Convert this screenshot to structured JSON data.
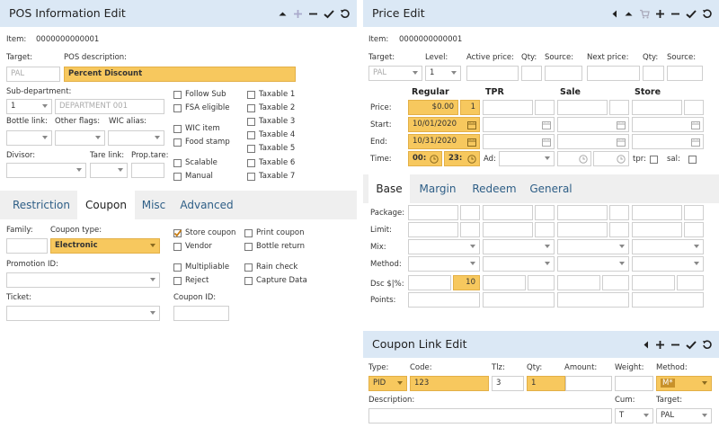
{
  "pos": {
    "title": "POS Information Edit",
    "item_label": "Item:",
    "item_value": "0000000000001",
    "target_label": "Target:",
    "target_value": "PAL",
    "posdesc_label": "POS description:",
    "posdesc_value": "Percent Discount",
    "subdept_label": "Sub-department:",
    "subdept_num": "1",
    "subdept_name": "DEPARTMENT 001",
    "bottle_label": "Bottle link:",
    "flags_label": "Other flags:",
    "wic_alias_label": "WIC alias:",
    "divisor_label": "Divisor:",
    "tare_label": "Tare link:",
    "prop_tare_label": "Prop.tare:",
    "checks_a": [
      "Follow Sub",
      "FSA eligible",
      "WIC item",
      "Food stamp",
      "Scalable",
      "Manual"
    ],
    "checks_b": [
      "Taxable 1",
      "Taxable 2",
      "Taxable 3",
      "Taxable 4",
      "Taxable 5",
      "Taxable 6",
      "Taxable 7"
    ],
    "tabs": [
      "Restriction",
      "Coupon",
      "Misc",
      "Advanced"
    ],
    "family_label": "Family:",
    "coupon_type_label": "Coupon type:",
    "coupon_type_value": "Electronic",
    "promo_label": "Promotion ID:",
    "ticket_label": "Ticket:",
    "coupon_id_label": "Coupon ID:",
    "coupon_checks": [
      "Store coupon",
      "Vendor",
      "Multipliable",
      "Reject"
    ],
    "coupon_checks_b": [
      "Print coupon",
      "Bottle return",
      "Rain check",
      "Capture Data"
    ]
  },
  "price": {
    "title": "Price Edit",
    "item_label": "Item:",
    "item_value": "0000000000001",
    "target_label": "Target:",
    "target_value": "PAL",
    "level_label": "Level:",
    "level_value": "1",
    "active_label": "Active price:",
    "qty_label": "Qty:",
    "source_label": "Source:",
    "next_label": "Next price:",
    "qty2_label": "Qty:",
    "source2_label": "Source:",
    "cols": [
      "Regular",
      "TPR",
      "Sale",
      "Store"
    ],
    "row_labels": [
      "Price:",
      "Start:",
      "End:",
      "Time:"
    ],
    "reg_price": "$0.00",
    "reg_qty": "1",
    "reg_start": "10/01/2020",
    "reg_end": "10/31/2020",
    "time_a": "00:",
    "time_b": "23:",
    "ad_label": "Ad:",
    "tpr_label": "tpr:",
    "sal_label": "sal:",
    "tabs": [
      "Base",
      "Margin",
      "Redeem",
      "General"
    ],
    "base_rows": [
      "Package:",
      "Limit:",
      "Mix:",
      "Method:",
      "Dsc $|%:",
      "Points:"
    ],
    "dsc_value": "10"
  },
  "coupon_link": {
    "title": "Coupon Link Edit",
    "type_label": "Type:",
    "code_label": "Code:",
    "tlz_label": "Tlz:",
    "qty_label": "Qty:",
    "amount_label": "Amount:",
    "weight_label": "Weight:",
    "method_label": "Method:",
    "type_value": "PID",
    "code_value": "123",
    "tlz_value": "3",
    "qty_value": "1",
    "method_value": "M*",
    "desc_label": "Description:",
    "cum_label": "Cum:",
    "cum_value": "T",
    "target_label": "Target:",
    "target_value": "PAL"
  },
  "colors": {
    "header_bg": "#dbe8f5",
    "highlight": "#f7c85e",
    "tab_text": "#2e5e86",
    "tab_bar": "#efefef"
  }
}
